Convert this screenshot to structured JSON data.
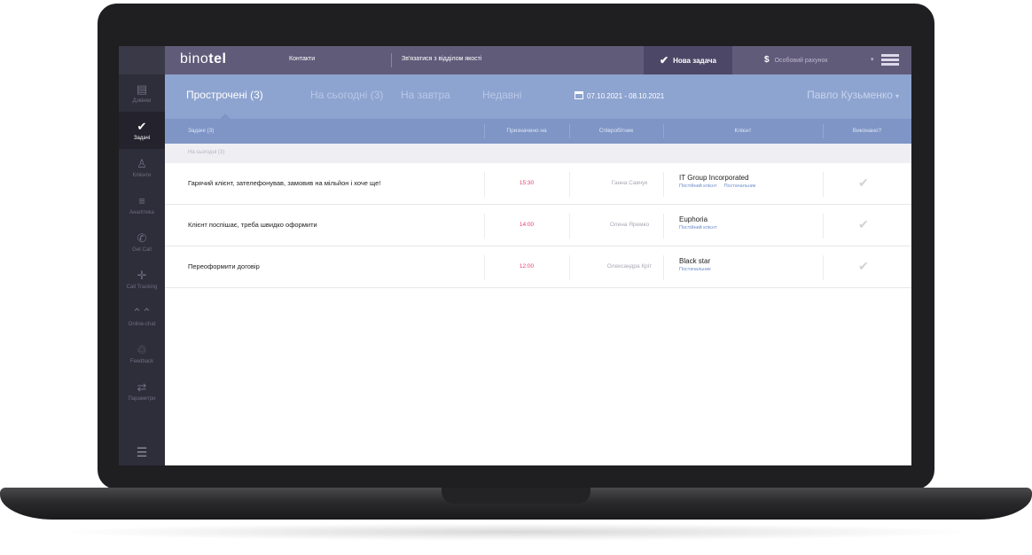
{
  "app": {
    "brand_prefix": "bino",
    "brand_bold": "tel"
  },
  "topbar": {
    "links": [
      "Контакти",
      "Зв'язатися з відділом якості"
    ],
    "new_task_label": "Нова задача",
    "account_label": "Особовий рахунок"
  },
  "sidebar": {
    "items": [
      {
        "label": "Дзвінки",
        "icon": "list-icon"
      },
      {
        "label": "Задачі",
        "icon": "check-icon"
      },
      {
        "label": "Клієнти",
        "icon": "user-icon"
      },
      {
        "label": "Аналітика",
        "icon": "chart-icon"
      },
      {
        "label": "Get Call",
        "icon": "phone-icon"
      },
      {
        "label": "Call Tracking",
        "icon": "tracking-icon"
      },
      {
        "label": "Online-chat",
        "icon": "chat-icon"
      },
      {
        "label": "Feedback",
        "icon": "feedback-icon"
      },
      {
        "label": "Параметри",
        "icon": "settings-icon"
      }
    ],
    "active_index": 1
  },
  "tabs": [
    {
      "label": "Прострочені (3)",
      "active": true
    },
    {
      "label": "На сьогодні (3)",
      "active": false
    },
    {
      "label": "На завтра",
      "active": false
    },
    {
      "label": "Недавні",
      "active": false
    }
  ],
  "date_range": "07.10.2021 - 08.10.2021",
  "user_name": "Павло Кузьменко",
  "table": {
    "headers": [
      "Задачі (3)",
      "Призначено на",
      "Співробітник",
      "Клієнт",
      "Виконано?"
    ],
    "group_label": "На сьогодні (3)",
    "rows": [
      {
        "task": "Гарячий клієнт, зателефонував, замовив на мільйон і хоче ще!",
        "time": "15:30",
        "employee": "Ганна Савчук",
        "client": "IT Group  Incorporated",
        "tags": [
          "Постійний клієнт",
          "Постачальник"
        ]
      },
      {
        "task": "Клієнт поспішає, треба швидко оформити",
        "time": "14:00",
        "employee": "Олена Яремко",
        "client": "Euphoria",
        "tags": [
          "Постійний клієнт"
        ]
      },
      {
        "task": "Переоформити договір",
        "time": "12:00",
        "employee": "Олександра Кріт",
        "client": "Black star",
        "tags": [
          "Постачальник"
        ]
      }
    ]
  },
  "colors": {
    "topbar": "#615b7a",
    "tabbar": "#8ea4d0",
    "table_header": "#7e95c6",
    "sidebar": "#2e2d3a",
    "time_accent": "#e8406a"
  }
}
